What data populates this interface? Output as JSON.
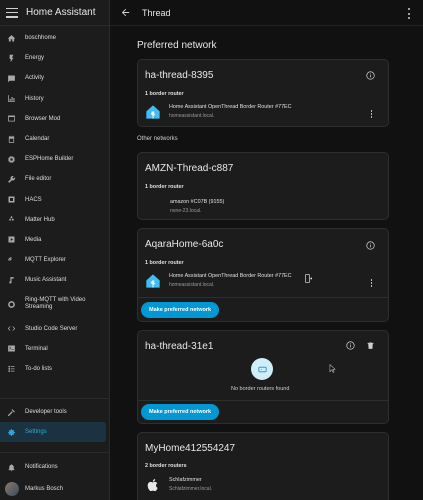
{
  "sidebar": {
    "title": "Home Assistant",
    "items": [
      {
        "label": "boschhome",
        "icon": "home-icon"
      },
      {
        "label": "Energy",
        "icon": "lightning-icon"
      },
      {
        "label": "Activity",
        "icon": "activity-icon"
      },
      {
        "label": "History",
        "icon": "chart-icon"
      },
      {
        "label": "Browser Mod",
        "icon": "browser-icon"
      },
      {
        "label": "Calendar",
        "icon": "calendar-icon"
      },
      {
        "label": "ESPHome Builder",
        "icon": "chip-icon"
      },
      {
        "label": "File editor",
        "icon": "wrench-icon"
      },
      {
        "label": "HACS",
        "icon": "hacs-icon"
      },
      {
        "label": "Matter Hub",
        "icon": "matter-icon"
      },
      {
        "label": "Media",
        "icon": "media-icon"
      },
      {
        "label": "MQTT Explorer",
        "icon": "mqtt-icon"
      },
      {
        "label": "Music Assistant",
        "icon": "music-icon"
      },
      {
        "label": "Ring-MQTT with Video Streaming",
        "icon": "ring-icon"
      },
      {
        "label": "Studio Code Server",
        "icon": "code-icon"
      },
      {
        "label": "Terminal",
        "icon": "terminal-icon"
      },
      {
        "label": "To-do lists",
        "icon": "todo-icon"
      }
    ],
    "developer_tools": "Developer tools",
    "settings": "Settings",
    "notifications": "Notifications",
    "user": "Markus Bosch"
  },
  "topbar": {
    "title": "Thread"
  },
  "preferred_heading": "Preferred network",
  "other_heading": "Other networks",
  "cards": [
    {
      "name": "ha-thread-8395",
      "count": "1 border router",
      "routers": [
        {
          "name": "Home Assistant OpenThread Border Router #77EC",
          "host": "homeassistant.local."
        }
      ]
    },
    {
      "name": "AMZN-Thread-c887",
      "count": "1 border router",
      "routers": [
        {
          "name": "amazon #C07B (9155)",
          "host": "none-23.local."
        }
      ]
    },
    {
      "name": "AqaraHome-6a0c",
      "count": "1 border router",
      "routers": [
        {
          "name": "Home Assistant OpenThread Border Router #77EC",
          "host": "homeassistant.local."
        }
      ],
      "button": "Make preferred network"
    },
    {
      "name": "ha-thread-31e1",
      "empty": "No border routers found",
      "button": "Make preferred network"
    },
    {
      "name": "MyHome412554247",
      "count": "2 border routers",
      "routers": [
        {
          "name": "Schlafzimmer",
          "host": "Schlafzimmer.local."
        }
      ]
    }
  ],
  "colors": {
    "accent": "#0398d4",
    "sidebar_bg": "#1c1c1c",
    "card_bg": "#1c1c1c",
    "page_bg": "#111111"
  }
}
